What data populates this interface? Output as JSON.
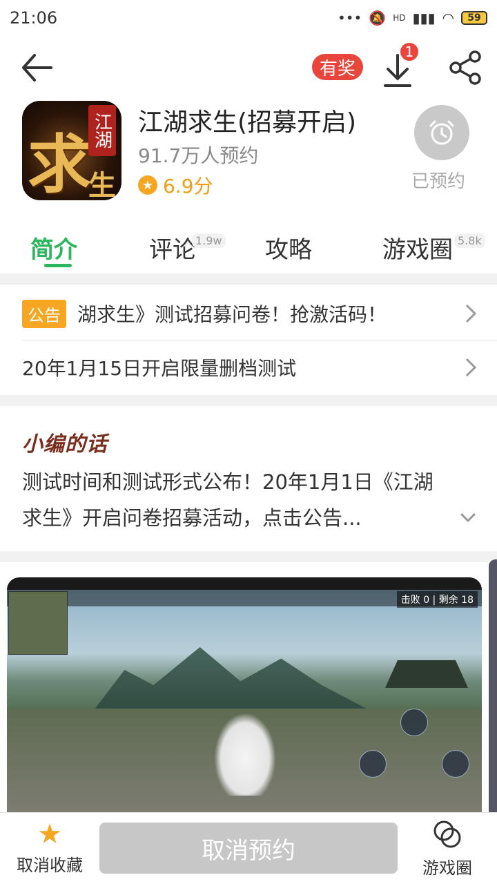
{
  "status_bar": {
    "time": "21:06",
    "network": "HD",
    "battery": "59"
  },
  "topnav": {
    "reward_label": "有奖",
    "download_badge": "1"
  },
  "app": {
    "title": "江湖求生(招募开启)",
    "reservations": "91.7万人预约",
    "rating": "6.9分",
    "reserve_status": "已预约",
    "icon_big_char": "求",
    "icon_tag": "江湖",
    "icon_small_char": "生"
  },
  "tabs": [
    {
      "label": "简介",
      "count": ""
    },
    {
      "label": "评论",
      "count": "1.9w"
    },
    {
      "label": "攻略",
      "count": ""
    },
    {
      "label": "游戏圈",
      "count": "5.8k"
    }
  ],
  "notices": [
    {
      "badge": "公告",
      "text": "湖求生》测试招募问卷！抢激活码！"
    },
    {
      "badge": "",
      "text": "20年1月15日开启限量删档测试"
    }
  ],
  "editor": {
    "title": "小编的话",
    "text": "测试时间和测试形式公布！20年1月1日《江湖求生》开启问卷招募活动，点击公告..."
  },
  "screenshot": {
    "hud_stats": "击败 0 | 剩余 18"
  },
  "bottom": {
    "favorite_label": "取消收藏",
    "cancel_label": "取消预约",
    "circle_label": "游戏圈"
  },
  "colors": {
    "accent": "#2db55d",
    "badge_red": "#e8453c",
    "star_orange": "#f6a623"
  }
}
